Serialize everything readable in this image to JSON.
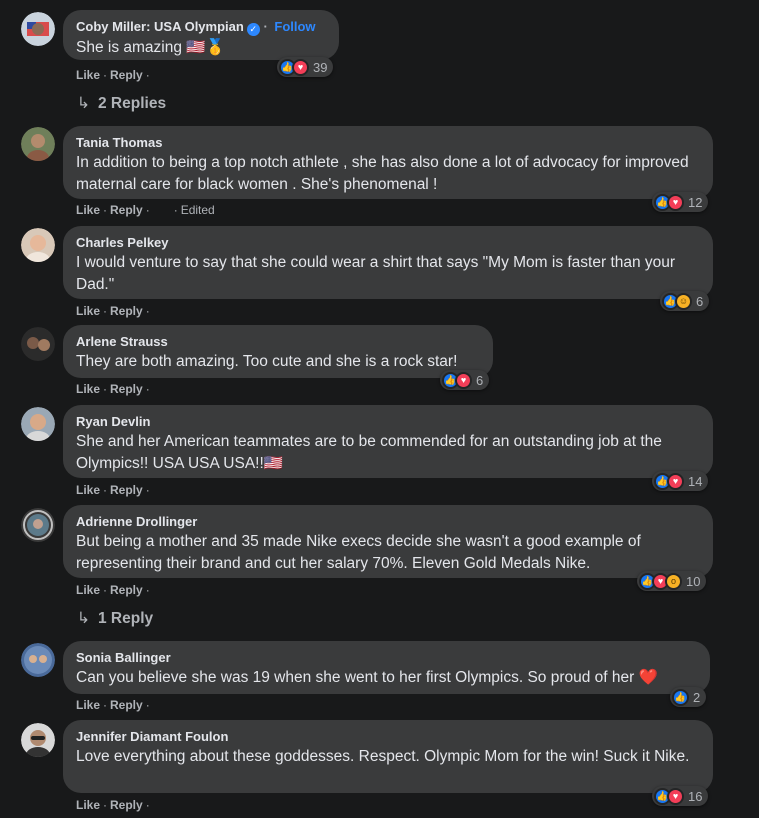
{
  "comments": [
    {
      "author": "Coby Miller: USA Olympian",
      "verified": true,
      "follow_label": "Follow",
      "text": "She is amazing 🇺🇸🥇",
      "like_label": "Like",
      "reply_label": "Reply",
      "reaction_count": "39",
      "replies_label": "2 Replies"
    },
    {
      "author": "Tania Thomas",
      "text": "In addition to being a top notch athlete , she has also done a lot of advocacy for improved maternal care for black women . She's phenomenal !",
      "like_label": "Like",
      "reply_label": "Reply",
      "edited_label": "Edited",
      "reaction_count": "12"
    },
    {
      "author": "Charles Pelkey",
      "text": "I would venture to say that she could wear a shirt that says \"My Mom is faster than your Dad.\"",
      "like_label": "Like",
      "reply_label": "Reply",
      "reaction_count": "6"
    },
    {
      "author": "Arlene Strauss",
      "text": "They are both amazing. Too cute and she is a rock star!",
      "like_label": "Like",
      "reply_label": "Reply",
      "reaction_count": "6"
    },
    {
      "author": "Ryan Devlin",
      "text": "She and her American teammates are to be commended for an outstanding job at the Olympics!! USA USA USA!!🇺🇸",
      "like_label": "Like",
      "reply_label": "Reply",
      "reaction_count": "14"
    },
    {
      "author": "Adrienne Drollinger",
      "text": "But being a mother and 35 made Nike execs decide she wasn't a good example of representing their brand and cut her salary 70%. Eleven Gold Medals Nike.",
      "like_label": "Like",
      "reply_label": "Reply",
      "reaction_count": "10",
      "replies_label": "1 Reply"
    },
    {
      "author": "Sonia Ballinger",
      "text": "Can you believe she was 19 when she went to her first Olympics. So proud of her ❤️",
      "like_label": "Like",
      "reply_label": "Reply",
      "reaction_count": "2"
    },
    {
      "author": "Jennifer Diamant Foulon",
      "text": "Love everything about these goddesses. Respect. Olympic Mom for the win! Suck it Nike.",
      "like_label": "Like",
      "reply_label": "Reply",
      "reaction_count": "16"
    }
  ],
  "colors": {
    "background": "#18191a",
    "bubble": "#3a3b3c",
    "text": "#e4e6eb",
    "muted": "#b0b3b8",
    "link": "#2d88ff",
    "like": "#1877f2",
    "love": "#f33e58",
    "haha": "#f7b125"
  },
  "icons": [
    "like-icon",
    "love-icon",
    "haha-icon",
    "wow-icon",
    "verified-badge-icon",
    "reply-arrow-icon"
  ]
}
